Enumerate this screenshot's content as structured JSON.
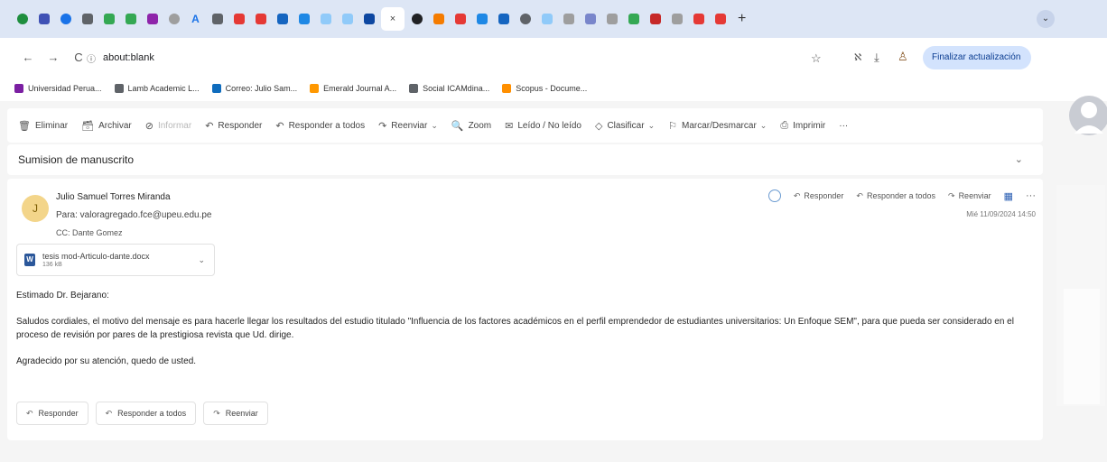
{
  "browser": {
    "tabs": [
      {
        "kind": "favicon",
        "color": "#1e8e3e",
        "shape": "circle",
        "icon": "green-circle"
      },
      {
        "kind": "favicon",
        "color": "#3f51b5",
        "shape": "square",
        "icon": "dash-app"
      },
      {
        "kind": "favicon",
        "color": "#1a73e8",
        "shape": "circle",
        "icon": "cloud-app"
      },
      {
        "kind": "favicon",
        "color": "#5f6368",
        "shape": "square",
        "icon": "doc-app"
      },
      {
        "kind": "favicon",
        "color": "#34a853",
        "shape": "square",
        "icon": "g-app"
      },
      {
        "kind": "favicon",
        "color": "#34a853",
        "shape": "square",
        "icon": "g-app-2"
      },
      {
        "kind": "favicon",
        "color": "#8e24aa",
        "shape": "square",
        "icon": "m-app"
      },
      {
        "kind": "favicon",
        "color": "#9e9e9e",
        "shape": "circle",
        "icon": "settings-app"
      },
      {
        "kind": "glyph",
        "glyph": "A",
        "color": "#1a73e8",
        "icon": "a-app"
      },
      {
        "kind": "favicon",
        "color": "#5f6368",
        "shape": "square",
        "icon": "list-app"
      },
      {
        "kind": "favicon",
        "color": "#e53935",
        "shape": "square",
        "icon": "youtube-app"
      },
      {
        "kind": "favicon",
        "color": "#e53935",
        "shape": "square",
        "icon": "youtube-app-2"
      },
      {
        "kind": "favicon",
        "color": "#1565c0",
        "shape": "square",
        "icon": "download-app"
      },
      {
        "kind": "favicon",
        "color": "#1e88e5",
        "shape": "square",
        "icon": "arrow-app"
      },
      {
        "kind": "favicon",
        "color": "#90caf9",
        "shape": "square",
        "icon": "doc-app-2"
      },
      {
        "kind": "favicon",
        "color": "#90caf9",
        "shape": "square",
        "icon": "doc-app-3"
      },
      {
        "kind": "favicon",
        "color": "#0d47a1",
        "shape": "square",
        "icon": "s-app"
      },
      {
        "kind": "close",
        "glyph": "×",
        "icon": "close-icon",
        "active": true
      },
      {
        "kind": "favicon",
        "color": "#202124",
        "shape": "circle",
        "icon": "c-app"
      },
      {
        "kind": "favicon",
        "color": "#f57c00",
        "shape": "square",
        "icon": "orange-app"
      },
      {
        "kind": "favicon",
        "color": "#e53935",
        "shape": "square",
        "icon": "youtube-app-3"
      },
      {
        "kind": "favicon",
        "color": "#1e88e5",
        "shape": "square",
        "icon": "arrow-app-2"
      },
      {
        "kind": "favicon",
        "color": "#1565c0",
        "shape": "square",
        "icon": "square-app"
      },
      {
        "kind": "favicon",
        "color": "#5f6368",
        "shape": "circle",
        "icon": "globe-app"
      },
      {
        "kind": "favicon",
        "color": "#90caf9",
        "shape": "square",
        "icon": "doc-app-4"
      },
      {
        "kind": "favicon",
        "color": "#9e9e9e",
        "shape": "square",
        "icon": "w-app"
      },
      {
        "kind": "favicon",
        "color": "#7986cb",
        "shape": "square",
        "icon": "g-app-3"
      },
      {
        "kind": "favicon",
        "color": "#9e9e9e",
        "shape": "square",
        "icon": "dash-app-2"
      },
      {
        "kind": "favicon",
        "color": "#34a853",
        "shape": "square",
        "icon": "g-app-4"
      },
      {
        "kind": "favicon",
        "color": "#c62828",
        "shape": "square",
        "icon": "d-app"
      },
      {
        "kind": "favicon",
        "color": "#9e9e9e",
        "shape": "square",
        "icon": "w-app-2"
      },
      {
        "kind": "favicon",
        "color": "#e53935",
        "shape": "square",
        "icon": "red-app"
      },
      {
        "kind": "favicon",
        "color": "#e53935",
        "shape": "square",
        "icon": "red-app-2"
      }
    ],
    "new_tab_glyph": "+",
    "tab_menu_glyph": "⌄",
    "back_glyph": "←",
    "forward_glyph": "→",
    "reload_glyph": "C",
    "info_glyph": "ⓘ",
    "url": "about:blank",
    "star_glyph": "☆",
    "update_button": "Finalizar actualización  ⋮"
  },
  "bookmarks": [
    {
      "label": "Universidad Perua...",
      "color": "#7b1fa2",
      "icon": "university-icon"
    },
    {
      "label": "Lamb Academic L...",
      "color": "#5f6368",
      "icon": "lamb-icon"
    },
    {
      "label": "Correo: Julio Sam...",
      "color": "#0f6cbd",
      "icon": "outlook-icon"
    },
    {
      "label": "Emerald Journal A...",
      "color": "#ff9800",
      "icon": "emerald-icon"
    },
    {
      "label": "Social ICAMdina...",
      "color": "#5f6368",
      "icon": "social-icon"
    },
    {
      "label": "Scopus - Docume...",
      "color": "#ff8f00",
      "icon": "scopus-icon"
    }
  ],
  "mail": {
    "commands": [
      {
        "label": "Eliminar",
        "icon": "🗑",
        "name": "delete-button"
      },
      {
        "label": "Archivar",
        "icon": "🗃",
        "name": "archive-button"
      },
      {
        "label": "Informar",
        "icon": "⊘",
        "name": "report-button",
        "disabled": true
      },
      {
        "label": "Responder",
        "icon": "↶",
        "name": "reply-button"
      },
      {
        "label": "Responder a todos",
        "icon": "↶",
        "name": "reply-all-button"
      },
      {
        "label": "Reenviar",
        "icon": "↷",
        "name": "forward-button",
        "dropdown": true
      },
      {
        "label": "Zoom",
        "icon": "🔍",
        "name": "zoom-button"
      },
      {
        "label": "Leído / No leído",
        "icon": "✉",
        "name": "read-unread-button"
      },
      {
        "label": "Clasificar",
        "icon": "◇",
        "name": "categorize-button",
        "dropdown": true
      },
      {
        "label": "Marcar/Desmarcar",
        "icon": "⚐",
        "name": "flag-button",
        "dropdown": true
      },
      {
        "label": "Imprimir",
        "icon": "⎙",
        "name": "print-button"
      },
      {
        "label": "···",
        "icon": "",
        "name": "more-commands-button"
      }
    ],
    "subject": "Sumision de manuscrito",
    "message": {
      "avatar_initial": "J",
      "sender": "Julio Samuel Torres Miranda",
      "to": "Para:  valoragregado.fce@upeu.edu.pe",
      "cc": "CC:  Dante Gomez",
      "date": "Mié 11/09/2024 14:50",
      "actions": [
        {
          "label": "Responder",
          "icon": "↶"
        },
        {
          "label": "Responder a todos",
          "icon": "↶"
        },
        {
          "label": "Reenviar",
          "icon": "↷"
        }
      ],
      "attachment": {
        "name": "tesis mod-Articulo-dante.docx",
        "size": "136 kB"
      },
      "greeting": "Estimado Dr. Bejarano:",
      "paragraph": "Saludos cordiales, el motivo del mensaje es para hacerle llegar los resultados del estudio titulado \"Influencia de los factores académicos en el perfil emprendedor de estudiantes universitarios: Un Enfoque SEM\", para que pueda ser considerado en el proceso de revisión por pares de la prestigiosa revista que Ud. dirige.",
      "closing": "Agradecido por su atención, quedo de usted.",
      "reply_buttons": [
        {
          "label": "Responder",
          "icon": "↶",
          "name": "bottom-reply-button"
        },
        {
          "label": "Responder a todos",
          "icon": "↶",
          "name": "bottom-reply-all-button"
        },
        {
          "label": "Reenviar",
          "icon": "↷",
          "name": "bottom-forward-button"
        }
      ]
    }
  }
}
